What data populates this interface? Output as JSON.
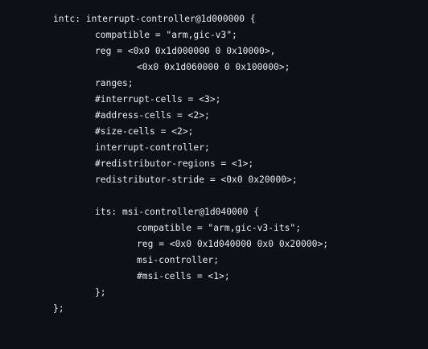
{
  "code": {
    "lines": [
      {
        "text": "intc: interrupt-controller@1d000000 {"
      },
      {
        "text": "compatible = \"arm,gic-v3\";"
      },
      {
        "text": "reg = <0x0 0x1d000000 0 0x10000>,"
      },
      {
        "text": "<0x0 0x1d060000 0 0x100000>;"
      },
      {
        "text": "ranges;"
      },
      {
        "text": "#interrupt-cells = <3>;"
      },
      {
        "text": "#address-cells = <2>;"
      },
      {
        "text": "#size-cells = <2>;"
      },
      {
        "text": "interrupt-controller;"
      },
      {
        "text": "#redistributor-regions = <1>;"
      },
      {
        "text": "redistributor-stride = <0x0 0x20000>;"
      },
      {
        "text": ""
      },
      {
        "text": "its: msi-controller@1d040000 {"
      },
      {
        "text": "compatible = \"arm,gic-v3-its\";"
      },
      {
        "text": "reg = <0x0 0x1d040000 0x0 0x20000>;"
      },
      {
        "text": "msi-controller;"
      },
      {
        "text": "#msi-cells = <1>;"
      },
      {
        "text": "};"
      },
      {
        "text": "};"
      }
    ]
  }
}
